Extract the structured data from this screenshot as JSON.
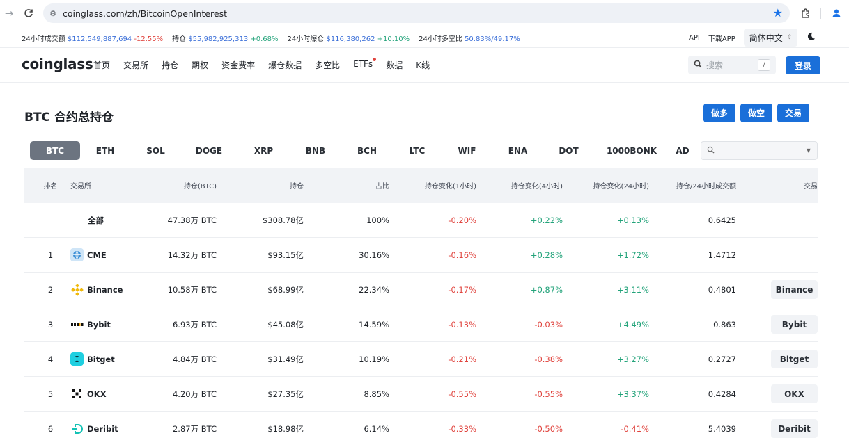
{
  "browser": {
    "url": "coinglass.com/zh/BitcoinOpenInterest"
  },
  "stats": {
    "vol_label": "24小时成交额",
    "vol_value": "$112,549,887,694",
    "vol_change": "-12.55%",
    "oi_label": "持仓",
    "oi_value": "$55,982,925,313",
    "oi_change": "+0.68%",
    "liq_label": "24小时爆仓",
    "liq_value": "$116,380,262",
    "liq_change": "+10.10%",
    "ls_label": "24小时多空比",
    "ls_value": "50.83%/49.17%",
    "api": "API",
    "app": "下载APP",
    "lang": "简体中文"
  },
  "nav": {
    "logo": "coinglass",
    "items": [
      "首页",
      "交易所",
      "持仓",
      "期权",
      "资金费率",
      "爆仓数据",
      "多空比",
      "ETFs",
      "数据",
      "K线"
    ],
    "search_placeholder": "搜索",
    "search_key": "/",
    "login": "登录"
  },
  "page": {
    "title": "BTC 合约总持仓",
    "long": "做多",
    "short": "做空",
    "trade": "交易"
  },
  "coins": [
    "BTC",
    "ETH",
    "SOL",
    "DOGE",
    "XRP",
    "BNB",
    "BCH",
    "LTC",
    "WIF",
    "ENA",
    "DOT",
    "1000BONK",
    "AD"
  ],
  "active_coin": "BTC",
  "table": {
    "headers": {
      "rank": "排名",
      "exchange": "交易所",
      "oi_btc": "持仓(BTC)",
      "oi": "持仓",
      "share": "占比",
      "ch1": "持仓变化(1小时)",
      "ch4": "持仓变化(4小时)",
      "ch24": "持仓变化(24小时)",
      "ratio": "持仓/24小时成交额",
      "trade": "交易"
    },
    "rows": [
      {
        "rank": "",
        "name": "全部",
        "oi_btc": "47.38万 BTC",
        "oi": "$308.78亿",
        "share": "100%",
        "ch1": "-0.20%",
        "ch4": "+0.22%",
        "ch24": "+0.13%",
        "ratio": "0.6425",
        "trade": ""
      },
      {
        "rank": "1",
        "name": "CME",
        "oi_btc": "14.32万 BTC",
        "oi": "$93.15亿",
        "share": "30.16%",
        "ch1": "-0.16%",
        "ch4": "+0.28%",
        "ch24": "+1.72%",
        "ratio": "1.4712",
        "trade": ""
      },
      {
        "rank": "2",
        "name": "Binance",
        "oi_btc": "10.58万 BTC",
        "oi": "$68.99亿",
        "share": "22.34%",
        "ch1": "-0.17%",
        "ch4": "+0.87%",
        "ch24": "+3.11%",
        "ratio": "0.4801",
        "trade": "Binance"
      },
      {
        "rank": "3",
        "name": "Bybit",
        "oi_btc": "6.93万 BTC",
        "oi": "$45.08亿",
        "share": "14.59%",
        "ch1": "-0.13%",
        "ch4": "-0.03%",
        "ch24": "+4.49%",
        "ratio": "0.863",
        "trade": "Bybit"
      },
      {
        "rank": "4",
        "name": "Bitget",
        "oi_btc": "4.84万 BTC",
        "oi": "$31.49亿",
        "share": "10.19%",
        "ch1": "-0.21%",
        "ch4": "-0.38%",
        "ch24": "+3.27%",
        "ratio": "0.2727",
        "trade": "Bitget"
      },
      {
        "rank": "5",
        "name": "OKX",
        "oi_btc": "4.20万 BTC",
        "oi": "$27.35亿",
        "share": "8.85%",
        "ch1": "-0.55%",
        "ch4": "-0.55%",
        "ch24": "+3.37%",
        "ratio": "0.4284",
        "trade": "OKX"
      },
      {
        "rank": "6",
        "name": "Deribit",
        "oi_btc": "2.87万 BTC",
        "oi": "$18.98亿",
        "share": "6.14%",
        "ch1": "-0.33%",
        "ch4": "-0.50%",
        "ch24": "-0.41%",
        "ratio": "5.4039",
        "trade": "Deribit"
      }
    ]
  },
  "icons": {
    "CME": "globe-icon",
    "Binance": "binance-diamond-icon",
    "Bybit": "bybit-wordmark-icon",
    "Bitget": "bitget-s-icon",
    "OKX": "okx-checker-icon",
    "Deribit": "deribit-d-icon"
  },
  "colors": {
    "accent": "#1a6fd9",
    "negative": "#e0433d",
    "positive": "#23a37a",
    "stat_blue": "#3b6fd8",
    "tab_active": "#6c7480"
  }
}
